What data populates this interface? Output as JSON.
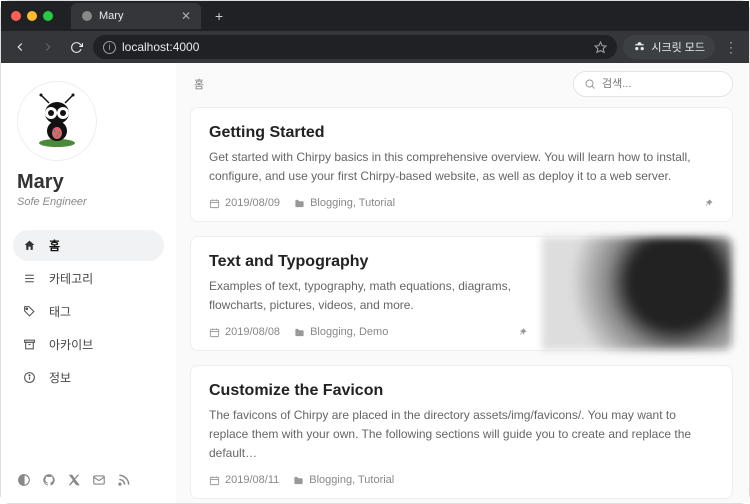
{
  "browser": {
    "tab_title": "Mary",
    "url": "localhost:4000",
    "incognito_label": "시크릿 모드"
  },
  "sidebar": {
    "title": "Mary",
    "subtitle": "Sofe Engineer",
    "nav": [
      {
        "label": "홈"
      },
      {
        "label": "카테고리"
      },
      {
        "label": "태그"
      },
      {
        "label": "아카이브"
      },
      {
        "label": "정보"
      }
    ]
  },
  "main": {
    "breadcrumb": "홈",
    "search_placeholder": "검색...",
    "posts": [
      {
        "title": "Getting Started",
        "excerpt": "Get started with Chirpy basics in this comprehensive overview. You will learn how to install, configure, and use your first Chirpy-based website, as well as deploy it to a web server.",
        "date": "2019/08/09",
        "categories": "Blogging, Tutorial"
      },
      {
        "title": "Text and Typography",
        "excerpt": "Examples of text, typography, math equations, diagrams, flowcharts, pictures, videos, and more.",
        "date": "2019/08/08",
        "categories": "Blogging, Demo"
      },
      {
        "title": "Customize the Favicon",
        "excerpt": "The favicons of Chirpy are placed in the directory assets/img/favicons/. You may want to replace them with your own. The following sections will guide you to create and replace the default…",
        "date": "2019/08/11",
        "categories": "Blogging, Tutorial"
      }
    ]
  }
}
